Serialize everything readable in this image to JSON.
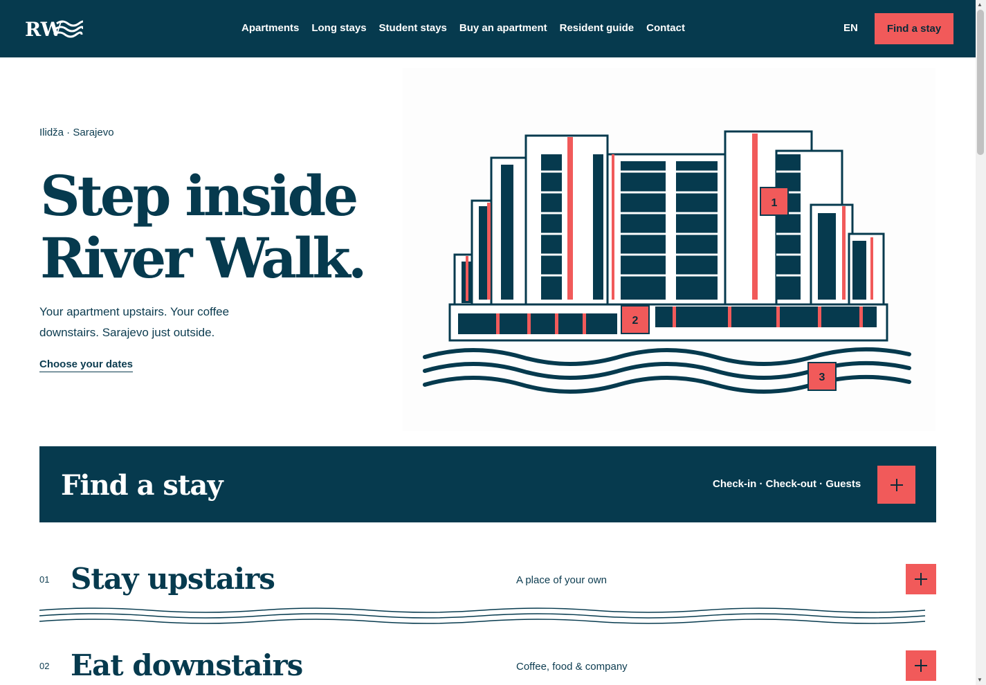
{
  "nav": {
    "logo_text": "RW",
    "links": [
      "Apartments",
      "Long stays",
      "Student stays",
      "Buy an apartment",
      "Resident guide",
      "Contact"
    ],
    "language": "EN",
    "cta_label": "Find a stay"
  },
  "hero": {
    "eyebrow": "Ilidža · Sarajevo",
    "title_line1": "Step inside",
    "title_line2": "River Walk.",
    "subtitle": "Your apartment upstairs. Your coffee downstairs. Sarajevo just outside.",
    "link_label": "Choose your dates"
  },
  "illustration": {
    "markers": [
      "1",
      "2",
      "3"
    ]
  },
  "find_stay": {
    "title": "Find a stay",
    "fields": "Check-in · Check-out · Guests"
  },
  "sections": [
    {
      "number": "01",
      "title": "Stay upstairs",
      "tagline": "A place of your own"
    },
    {
      "number": "02",
      "title": "Eat downstairs",
      "tagline": "Coffee, food & company"
    }
  ],
  "colors": {
    "navy": "#063a4e",
    "coral": "#f15a5a",
    "white": "#ffffff"
  }
}
